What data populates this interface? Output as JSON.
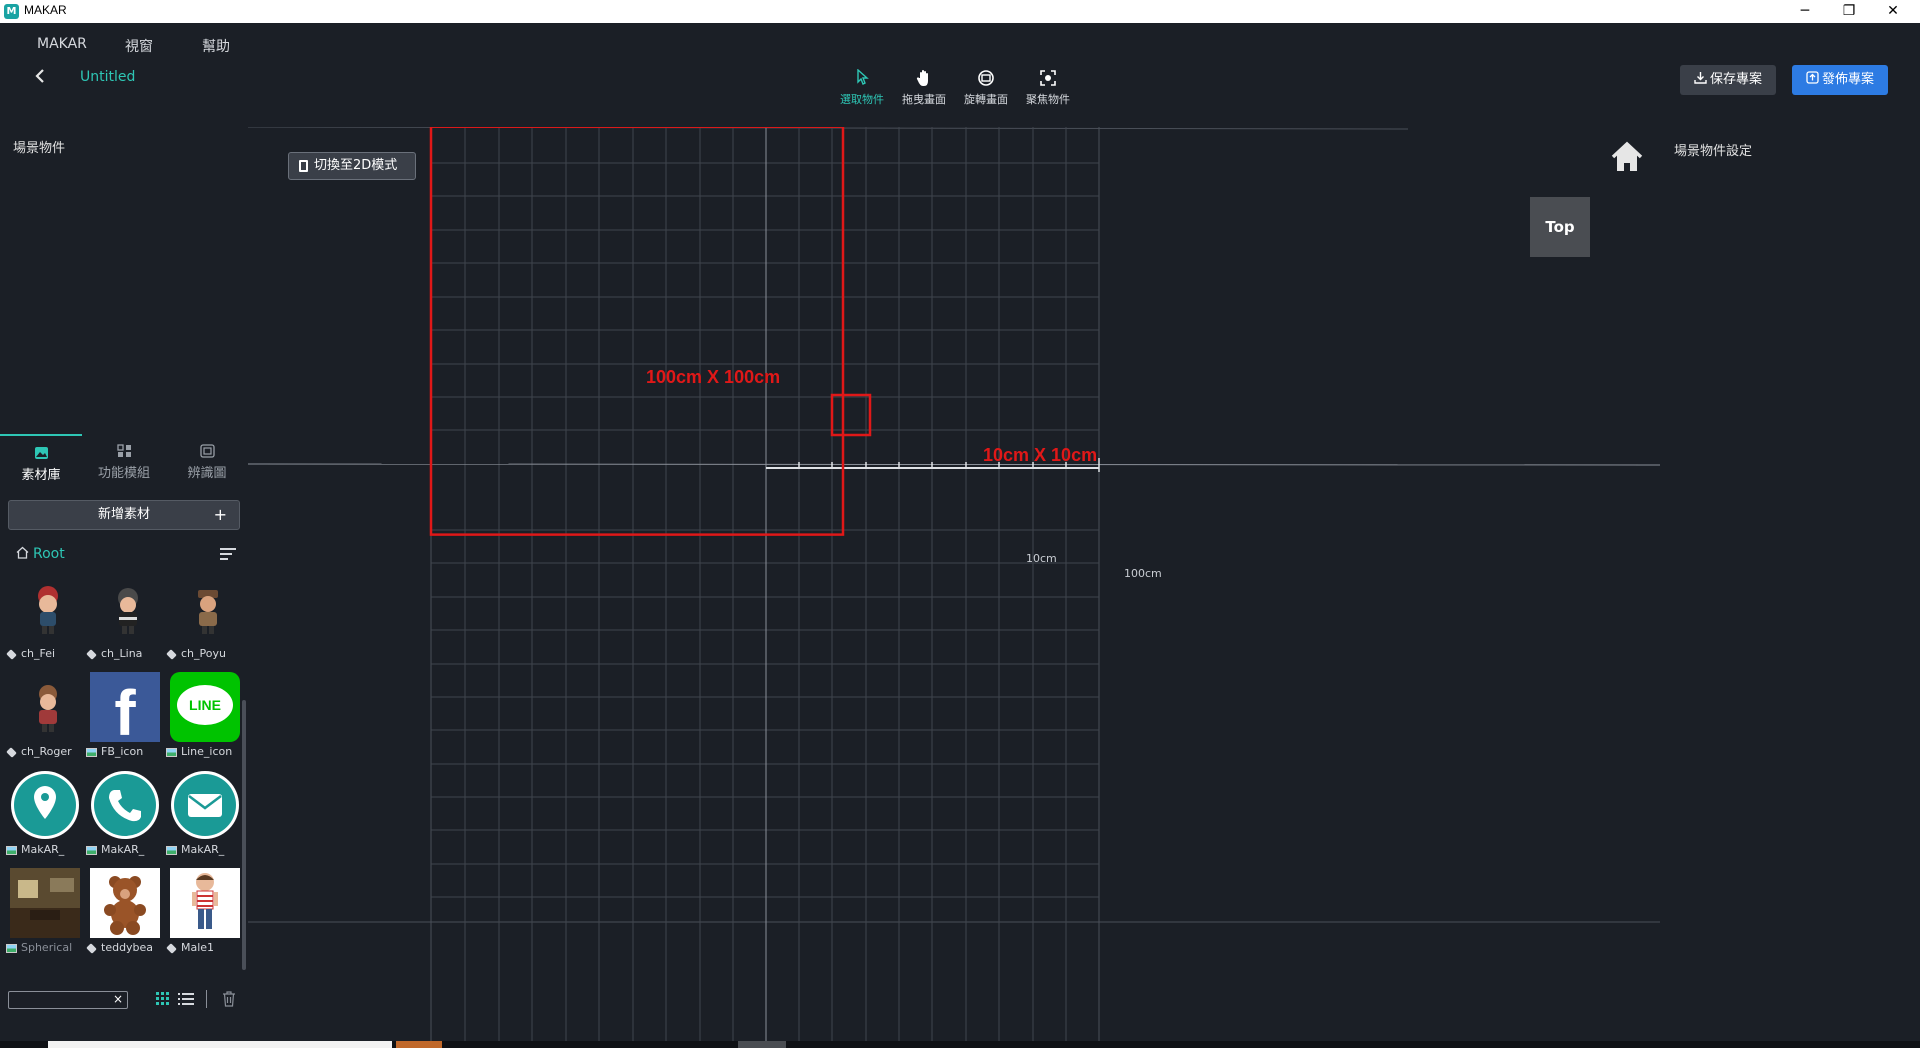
{
  "window": {
    "title": "MAKAR",
    "minimize": "─",
    "maximize": "❐",
    "close": "✕"
  },
  "menu": [
    "MAKAR",
    "視窗",
    "幫助"
  ],
  "header": {
    "back_icon": "chevron-left-icon",
    "project_title": "Untitled"
  },
  "toolbar": [
    {
      "label": "選取物件",
      "icon": "cursor-icon",
      "active": true
    },
    {
      "label": "拖曳畫面",
      "icon": "hand-icon",
      "active": false
    },
    {
      "label": "旋轉畫面",
      "icon": "rotate-icon",
      "active": false
    },
    {
      "label": "聚焦物件",
      "icon": "focus-icon",
      "active": false
    }
  ],
  "actions": {
    "save_label": "保存專案",
    "publish_label": "發佈專案"
  },
  "left_panel": {
    "scene_title": "場景物件",
    "tabs": [
      {
        "label": "素材庫",
        "icon": "image-icon",
        "active": true
      },
      {
        "label": "功能模組",
        "icon": "modules-icon",
        "active": false
      },
      {
        "label": "辨識圖",
        "icon": "scan-icon",
        "active": false
      }
    ],
    "add_label": "新增素材",
    "add_plus": "+",
    "root_label": "Root",
    "assets": [
      {
        "name": "ch_Fei",
        "type": "3d"
      },
      {
        "name": "ch_Lina",
        "type": "3d"
      },
      {
        "name": "ch_Poyu",
        "type": "3d"
      },
      {
        "name": "ch_Roger",
        "type": "3d"
      },
      {
        "name": "FB_icon",
        "type": "image"
      },
      {
        "name": "Line_icon",
        "type": "image"
      },
      {
        "name": "MakAR_",
        "type": "image"
      },
      {
        "name": "MakAR_",
        "type": "image"
      },
      {
        "name": "MakAR_",
        "type": "image"
      },
      {
        "name": "Spherical",
        "type": "image"
      },
      {
        "name": "teddybea",
        "type": "3d"
      },
      {
        "name": "Male1",
        "type": "3d"
      }
    ],
    "search_clear": "×"
  },
  "viewport": {
    "switch_label": "切換至2D模式",
    "view_label": "Top",
    "annotation_large": "100cm X 100cm",
    "annotation_small": "10cm X 10cm",
    "scale_small": "10cm",
    "scale_large": "100cm",
    "fb_glyph": "f",
    "line_glyph": "LINE"
  },
  "right_panel": {
    "title": "場景物件設定"
  },
  "colors": {
    "accent": "#2ec6b5",
    "publish": "#2d7be3",
    "annotation": "#e01818",
    "background": "#1b1f26"
  }
}
